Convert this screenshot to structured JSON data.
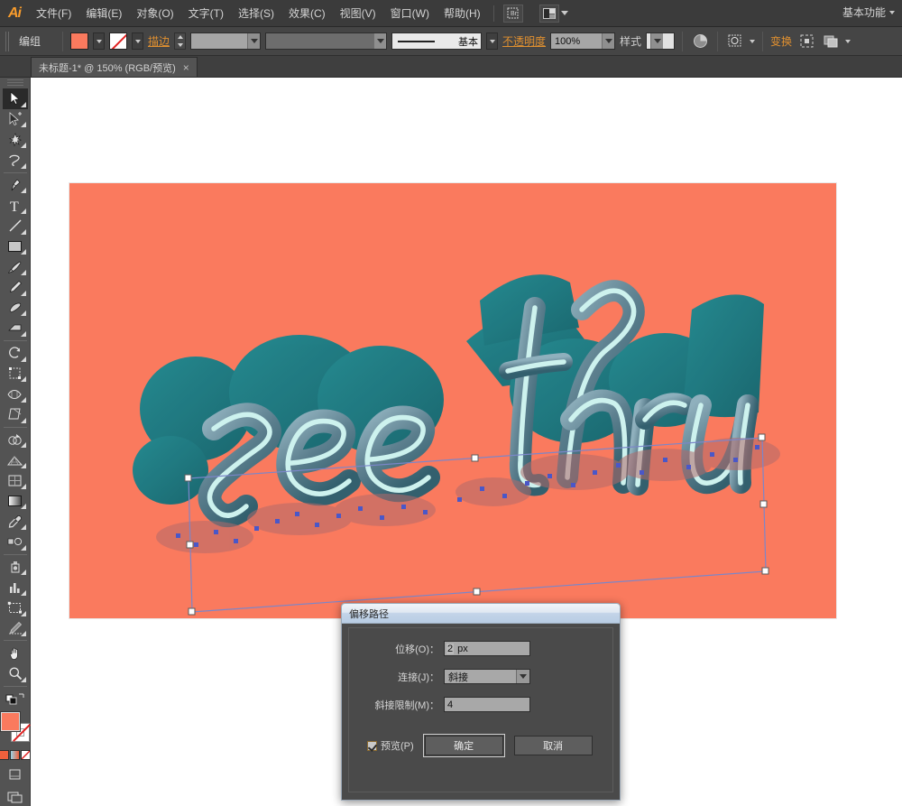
{
  "app": {
    "logo": "Ai",
    "workspace": "基本功能"
  },
  "menubar": {
    "items": [
      {
        "label": "文件(F)"
      },
      {
        "label": "编辑(E)"
      },
      {
        "label": "对象(O)"
      },
      {
        "label": "文字(T)"
      },
      {
        "label": "选择(S)"
      },
      {
        "label": "效果(C)"
      },
      {
        "label": "视图(V)"
      },
      {
        "label": "窗口(W)"
      },
      {
        "label": "帮助(H)"
      }
    ],
    "bridge_icon": "bridge-icon",
    "arrange_icon": "arrange-documents-icon"
  },
  "controlbar": {
    "selection_label": "编组",
    "fill_swatch_color": "#fa7a5e",
    "stroke_swatch": "none",
    "stroke_link_label": "描边",
    "stroke_weight": "",
    "stroke_dash": "",
    "profile_label": "基本",
    "opacity_label": "不透明度",
    "opacity_value": "100%",
    "style_label": "样式",
    "transform_label": "变换",
    "icons": {
      "recolor": "recolor-artwork-icon",
      "opacity_mask": "opacity-mask-icon",
      "align": "align-icon",
      "arrange": "arrange-icon"
    }
  },
  "tabbar": {
    "tab_title": "未标题-1* @ 150% (RGB/预览)",
    "close": "×"
  },
  "toolbar": {
    "tools": [
      {
        "name": "selection-tool",
        "active": true
      },
      {
        "name": "direct-selection-tool",
        "active": false
      },
      {
        "name": "magic-wand-tool",
        "active": false
      },
      {
        "name": "lasso-tool",
        "active": false
      },
      {
        "name": "pen-tool",
        "active": false
      },
      {
        "name": "type-tool",
        "active": false
      },
      {
        "name": "line-segment-tool",
        "active": false
      },
      {
        "name": "rectangle-tool",
        "active": false
      },
      {
        "name": "paintbrush-tool",
        "active": false
      },
      {
        "name": "pencil-tool",
        "active": false
      },
      {
        "name": "blob-brush-tool",
        "active": false
      },
      {
        "name": "eraser-tool",
        "active": false
      },
      {
        "name": "rotate-tool",
        "active": false
      },
      {
        "name": "scale-tool",
        "active": false
      },
      {
        "name": "width-tool",
        "active": false
      },
      {
        "name": "free-transform-tool",
        "active": false
      },
      {
        "name": "shape-builder-tool",
        "active": false
      },
      {
        "name": "perspective-grid-tool",
        "active": false
      },
      {
        "name": "mesh-tool",
        "active": false
      },
      {
        "name": "gradient-tool",
        "active": false
      },
      {
        "name": "eyedropper-tool",
        "active": false
      },
      {
        "name": "blend-tool",
        "active": false
      },
      {
        "name": "symbol-sprayer-tool",
        "active": false
      },
      {
        "name": "column-graph-tool",
        "active": false
      },
      {
        "name": "artboard-tool",
        "active": false
      },
      {
        "name": "slice-tool",
        "active": false
      },
      {
        "name": "hand-tool",
        "active": false
      },
      {
        "name": "zoom-tool",
        "active": false
      }
    ],
    "fill_color": "#fa7a5e",
    "stroke_color": "none",
    "color_modes": [
      "color-swatch-icon",
      "gradient-icon",
      "none-icon"
    ],
    "screen_modes": [
      "change-screen-mode-icon"
    ]
  },
  "artwork": {
    "text": "see thru",
    "background_color": "#fa7a5e",
    "letter_color": "#1f8f97",
    "letter_shadow_color": "#17767d",
    "outline_color": "#cdf2ee",
    "selection_accent": "#4a57c8",
    "zoom": "150%"
  },
  "dialog": {
    "title": "偏移路径",
    "offset_label": "位移(O)：",
    "offset_value": "2",
    "offset_unit": "px",
    "join_label": "连接(J)：",
    "join_value": "斜接",
    "miter_label": "斜接限制(M)：",
    "miter_value": "4",
    "preview_label": "预览(P)",
    "preview_checked": true,
    "ok_label": "确定",
    "cancel_label": "取消"
  }
}
